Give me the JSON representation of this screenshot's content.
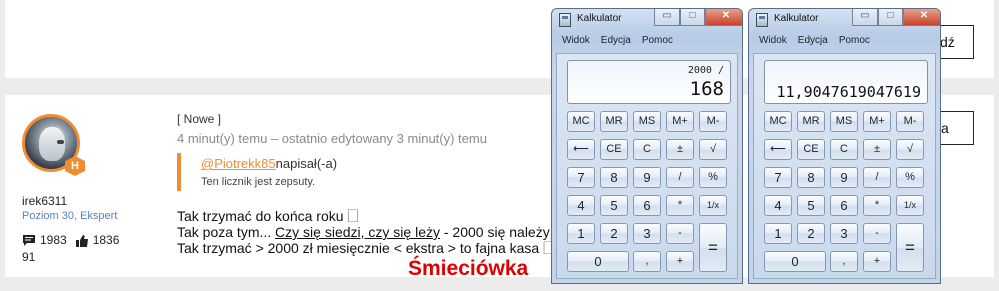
{
  "forum": {
    "top_button_label": "dź",
    "post_button_label": "a",
    "user": {
      "name": "irek6311",
      "rank": "Poziom 30, Ekspert",
      "badge_letter": "H",
      "posts": "1983",
      "likes": "1836",
      "solutions": "91"
    },
    "post": {
      "tag": "[ Nowe ]",
      "time": "4 minut(y) temu – ostatnio edytowany 3 minut(y) temu",
      "quote_author": "@Piotrekk85",
      "quote_verb": "napisał(-a)",
      "quote_text": "Ten licznik jest zepsuty.",
      "line1": "Tak trzymać do końca roku 🗌",
      "line2_prefix": "Tak poza tym...",
      "line2_link": "Czy się siedzi, czy się leży",
      "line2_suffix": "- 2000 się należy",
      "line3": "Tak trzymać > 2000 zł miesięcznie < ekstra > to fajna kasa 🗌"
    },
    "overlay_label": "Śmieciówka"
  },
  "calculators": [
    {
      "title": "Kalkulator",
      "menu": [
        "Widok",
        "Edycja",
        "Pomoc"
      ],
      "display_expression": "2000 /",
      "display_value": "168"
    },
    {
      "title": "Kalkulator",
      "menu": [
        "Widok",
        "Edycja",
        "Pomoc"
      ],
      "display_expression": "",
      "display_value": "11,9047619047619"
    }
  ],
  "keys": {
    "row1": [
      "MC",
      "MR",
      "MS",
      "M+",
      "M-"
    ],
    "row2": [
      "⟵",
      "CE",
      "C",
      "±",
      "√"
    ],
    "row3": [
      "7",
      "8",
      "9",
      "/",
      "%"
    ],
    "row4": [
      "4",
      "5",
      "6",
      "*",
      "1/x"
    ],
    "row5": [
      "1",
      "2",
      "3",
      "-"
    ],
    "row6": [
      "0",
      ",",
      "+"
    ],
    "equals": "="
  },
  "window_buttons": {
    "minimize": "▭",
    "maximize": "□",
    "close": "✕"
  },
  "colors": {
    "accent_orange": "#f08c32",
    "rank_blue": "#5d7fc6",
    "overlay_red": "#e00000"
  }
}
